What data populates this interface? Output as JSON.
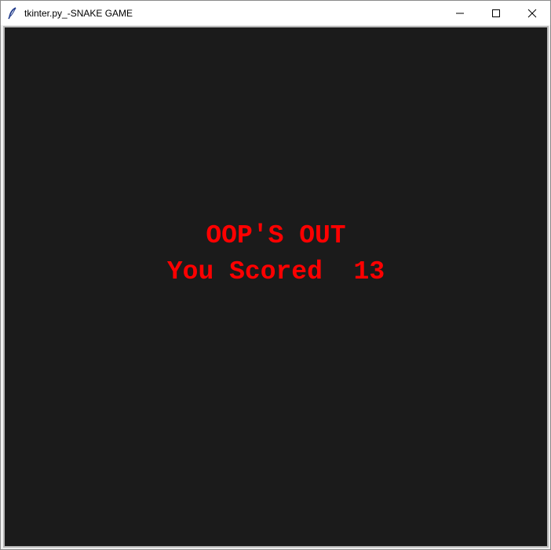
{
  "window": {
    "title": "tkinter.py_-SNAKE GAME",
    "icon": "feather-icon",
    "controls": [
      "minimize-icon",
      "maximize-icon",
      "close-icon"
    ]
  },
  "game": {
    "message_line1": "OOP'S OUT",
    "message_line2": "You Scored  13",
    "score": 13
  },
  "colors": {
    "canvas_background": "#1b1b1b",
    "message_text": "#ff0000"
  }
}
